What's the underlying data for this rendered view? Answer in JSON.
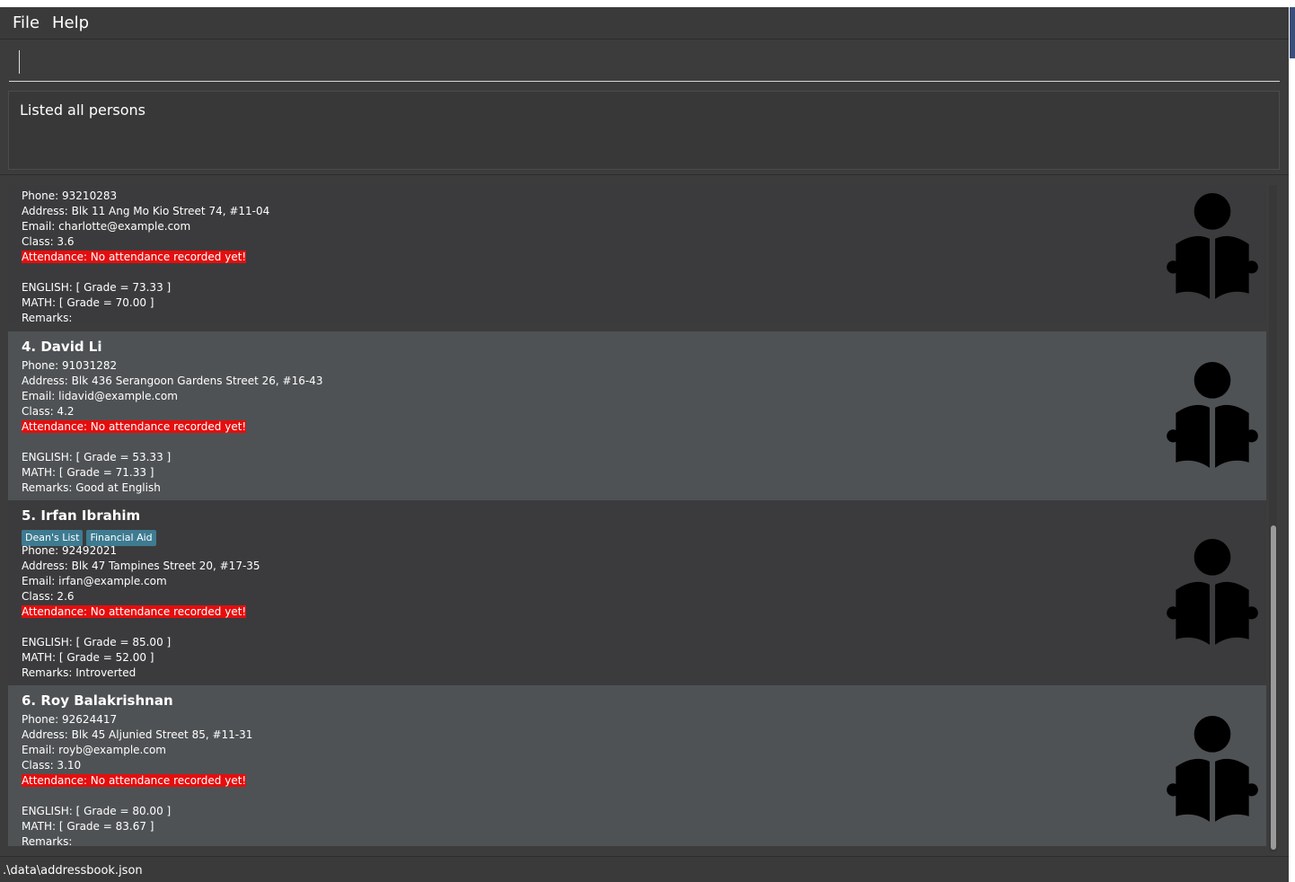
{
  "menu": {
    "file": "File",
    "help": "Help"
  },
  "command_box": {
    "value": "",
    "placeholder": ""
  },
  "result_display": {
    "text": "Listed all persons"
  },
  "persons": [
    {
      "name": "",
      "tags": [],
      "phone": "Phone: 93210283",
      "address": "Address: Blk 11 Ang Mo Kio Street 74, #11-04",
      "email": "Email: charlotte@example.com",
      "class": "Class: 3.6",
      "attendance": "Attendance: No attendance recorded yet!",
      "english": "ENGLISH: [ Grade = 73.33 ]",
      "math": "MATH: [ Grade = 70.00 ]",
      "remarks": "Remarks:",
      "icon": "student-reading-icon"
    },
    {
      "name": "4. David Li",
      "tags": [],
      "phone": "Phone: 91031282",
      "address": "Address: Blk 436 Serangoon Gardens Street 26, #16-43",
      "email": "Email: lidavid@example.com",
      "class": "Class: 4.2",
      "attendance": "Attendance: No attendance recorded yet!",
      "english": "ENGLISH: [ Grade = 53.33 ]",
      "math": "MATH: [ Grade = 71.33 ]",
      "remarks": "Remarks: Good at English",
      "icon": "student-reading-icon"
    },
    {
      "name": "5. Irfan Ibrahim",
      "tags": [
        "Dean's List",
        "Financial Aid"
      ],
      "phone": "Phone: 92492021",
      "address": "Address: Blk 47 Tampines Street 20, #17-35",
      "email": "Email: irfan@example.com",
      "class": "Class: 2.6",
      "attendance": "Attendance: No attendance recorded yet!",
      "english": "ENGLISH: [ Grade = 85.00 ]",
      "math": "MATH: [ Grade = 52.00 ]",
      "remarks": "Remarks: Introverted",
      "icon": "student-reading-icon"
    },
    {
      "name": "6. Roy Balakrishnan",
      "tags": [],
      "phone": "Phone: 92624417",
      "address": "Address: Blk 45 Aljunied Street 85, #11-31",
      "email": "Email: royb@example.com",
      "class": "Class: 3.10",
      "attendance": "Attendance: No attendance recorded yet!",
      "english": "ENGLISH: [ Grade = 80.00 ]",
      "math": "MATH: [ Grade = 83.67 ]",
      "remarks": "Remarks:",
      "icon": "student-reading-icon"
    }
  ],
  "status_bar": {
    "path": ".\\data\\addressbook.json"
  },
  "colors": {
    "background": "#3c3c3c",
    "card_dark": "#3b3b3d",
    "card_light": "#4f5254",
    "attendance_highlight": "#e60d0d",
    "tag": "#3e7b91",
    "text": "#ffffff"
  }
}
